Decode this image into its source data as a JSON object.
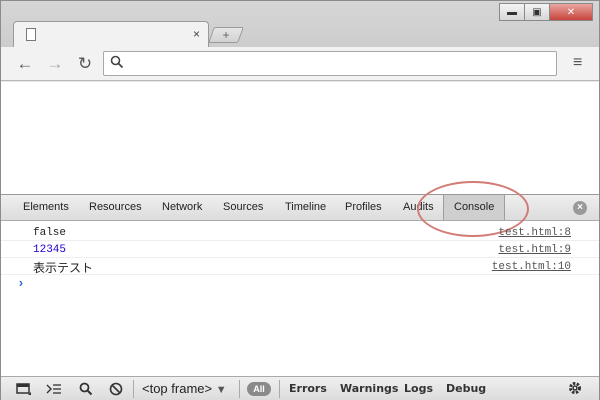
{
  "browser": {
    "window_controls": {
      "minimize": "▬",
      "maximize": "▣",
      "close": "✕"
    },
    "tab": {
      "close": "×"
    },
    "new_tab": "+",
    "toolbar": {
      "back": "←",
      "forward": "→",
      "reload": "↻",
      "search_icon": "search-icon",
      "address_value": "",
      "menu": "≡"
    }
  },
  "devtools": {
    "tabs": [
      "Elements",
      "Resources",
      "Network",
      "Sources",
      "Timeline",
      "Profiles",
      "Audits",
      "Console"
    ],
    "active_tab": "Console",
    "close": "×",
    "console": {
      "rows": [
        {
          "message": "false",
          "source": "test.html:8"
        },
        {
          "message": "12345",
          "source": "test.html:9"
        },
        {
          "message": "表示テスト",
          "source": "test.html:10"
        }
      ],
      "prompt": "›"
    },
    "statusbar": {
      "frame": "<top frame>",
      "frame_arrow": "▼",
      "all": "All",
      "filters": [
        "Errors",
        "Warnings",
        "Logs",
        "Debug"
      ]
    }
  },
  "colors": {
    "number_value": "#1c00cf",
    "prompt": "#2f6fd4",
    "annotation_ring": "#d27c76"
  }
}
